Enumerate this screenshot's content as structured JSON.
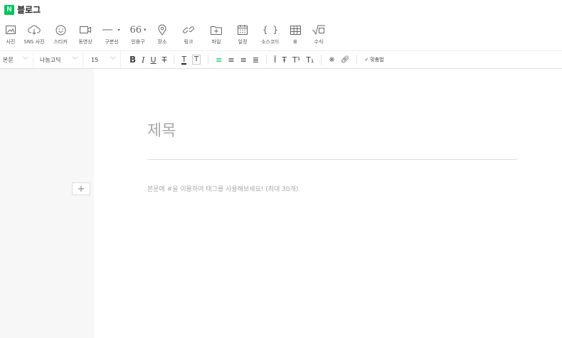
{
  "app": {
    "logo_letter": "N",
    "brand": "블로그"
  },
  "toolbar": {
    "items": [
      {
        "id": "photo",
        "label": "사진",
        "icon": "image-icon"
      },
      {
        "id": "sns-photo",
        "label": "SNS 사진",
        "icon": "cloud-download-icon"
      },
      {
        "id": "sticker",
        "label": "스티커",
        "icon": "smiley-icon"
      },
      {
        "id": "video",
        "label": "동영상",
        "icon": "video-icon"
      },
      {
        "id": "divider",
        "label": "구분선",
        "icon": "horizontal-line-icon"
      },
      {
        "id": "quote",
        "label": "인용구",
        "icon": "quote-icon"
      },
      {
        "id": "place",
        "label": "장소",
        "icon": "location-pin-icon"
      },
      {
        "id": "link",
        "label": "링크",
        "icon": "link-icon"
      },
      {
        "id": "file",
        "label": "파일",
        "icon": "file-icon"
      },
      {
        "id": "schedule",
        "label": "일정",
        "icon": "calendar-icon"
      },
      {
        "id": "code",
        "label": "소스코드",
        "icon": "code-braces-icon"
      },
      {
        "id": "table",
        "label": "표",
        "icon": "table-icon"
      },
      {
        "id": "formula",
        "label": "수식",
        "icon": "sqrt-icon"
      }
    ]
  },
  "format": {
    "style": "본문",
    "font": "나눔고딕",
    "size": "15",
    "spellcheck": "맞춤법"
  },
  "editor": {
    "title_placeholder": "제목",
    "body_placeholder": "본문에 #을 이용하여 태그를 사용해보세요! (최대 30개)",
    "add_button": "+"
  }
}
